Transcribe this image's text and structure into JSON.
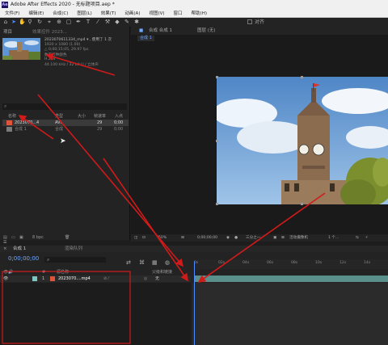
{
  "title_bar": {
    "text": "Adobe After Effects 2020 - 无标题项目.aep *",
    "logo_text": "Ae"
  },
  "menu": [
    "文件(F)",
    "编辑(E)",
    "合成(C)",
    "图层(L)",
    "效果(T)",
    "动画(A)",
    "视图(V)",
    "窗口",
    "帮助(H)"
  ],
  "toolbar": {
    "snap_label": "对齐"
  },
  "project_panel": {
    "tab_label": "项目",
    "effect_tab_label": "效果控件 2023...",
    "clip_name": "2023070611334_mp4 ▾ , 使用了 1 次",
    "clip_meta": [
      "1920 x 1080 (1.00)",
      "△ 0;00;15;05, 29.97 fps",
      "数百万种颜色",
      "H.264",
      "44.100 kHz / 32 bit U / 立体声"
    ],
    "columns": [
      "名称",
      "类型",
      "大小",
      "帧速率",
      "入点"
    ],
    "rows": [
      {
        "name": "2023070...4",
        "type": "AVI",
        "fps": "29",
        "inpoint": "0;00",
        "color": "#e0553a"
      },
      {
        "name": "合成 1",
        "type": "合成",
        "fps": "29",
        "inpoint": "0;00",
        "color": "#8a8a8a"
      }
    ],
    "footer_bpc": "8 bpc"
  },
  "comp_panel": {
    "header_label": "合成 合成 1",
    "layer_label": "图层 (无)",
    "tab_label": "合成 1",
    "footer": {
      "zoom": "50%",
      "timecode": "0;00;00;00",
      "resolution": "三分之一",
      "camera": "活动摄像机",
      "views": "1 个..."
    }
  },
  "timeline": {
    "tab_label": "合成 1",
    "render_queue_label": "渲染队列",
    "timecode": "0;00;00;00",
    "search_icon": "⌕",
    "columns": [
      "#",
      "源名称",
      "父级和链接"
    ],
    "layer": {
      "index": "1",
      "name": "2023070....mp4",
      "parent": "无"
    },
    "ruler_ticks": [
      "0s",
      "02s",
      "04s",
      "06s",
      "08s",
      "10s",
      "12s",
      "14s"
    ]
  },
  "colors": {
    "accent": "#4b8cff",
    "track": "#5b8f8b",
    "label_red": "#e0553a",
    "arrow": "#d11a1a"
  }
}
